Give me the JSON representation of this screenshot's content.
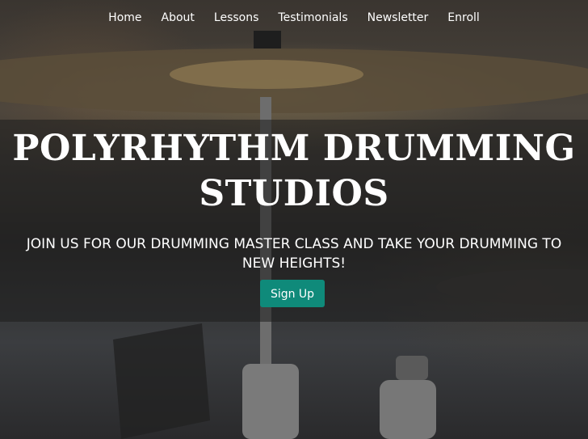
{
  "nav": {
    "items": [
      {
        "label": "Home"
      },
      {
        "label": "About"
      },
      {
        "label": "Lessons"
      },
      {
        "label": "Testimonials"
      },
      {
        "label": "Newsletter"
      },
      {
        "label": "Enroll"
      }
    ]
  },
  "hero": {
    "title_line1": "POLYRHYTHM DRUMMING",
    "title_line2": "STUDIOS",
    "subtitle_line1": "JOIN US FOR OUR DRUMMING MASTER CLASS AND TAKE YOUR DRUMMING TO",
    "subtitle_line2": "NEW HEIGHTS!",
    "cta_label": "Sign Up"
  },
  "colors": {
    "cta_background": "#0f8a7a",
    "text": "#ffffff",
    "overlay": "rgba(30,30,30,0.55)"
  }
}
